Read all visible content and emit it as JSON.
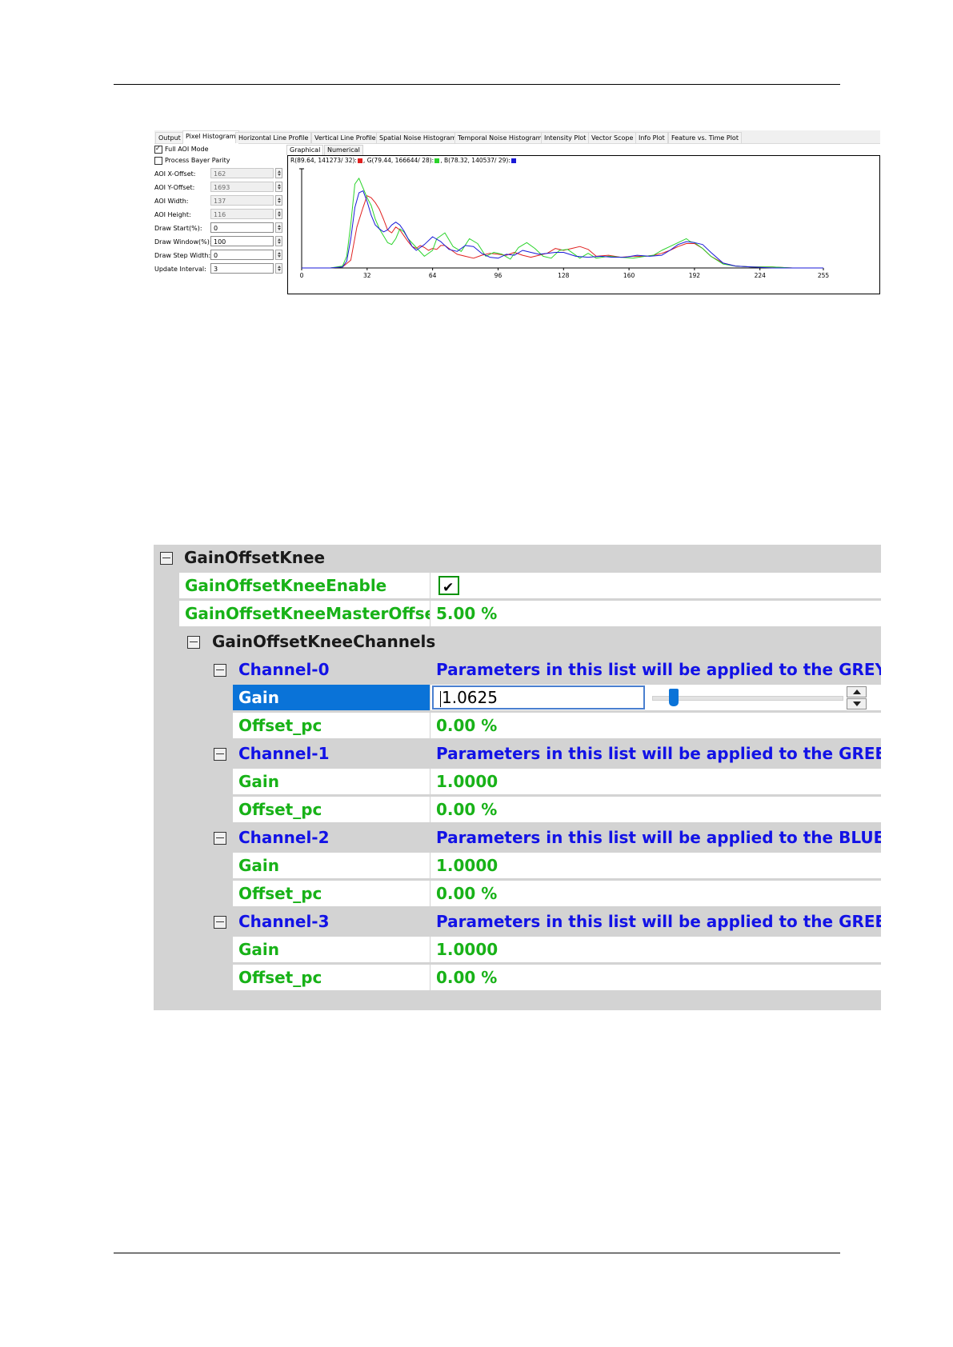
{
  "histogram_panel": {
    "tabs": [
      "Output",
      "Pixel Histogram",
      "Horizontal Line Profile",
      "Vertical Line Profile",
      "Spatial Noise Histogram",
      "Temporal Noise Histogram",
      "Intensity Plot",
      "Vector Scope",
      "Info Plot",
      "Feature vs. Time Plot"
    ],
    "active_tab": "Pixel Histogram",
    "checkboxes": [
      {
        "label": "Full AOI Mode",
        "checked": true
      },
      {
        "label": "Process Bayer Parity",
        "checked": false
      }
    ],
    "params": [
      {
        "label": "AOI X-Offset:",
        "value": "162",
        "editable": false
      },
      {
        "label": "AOI Y-Offset:",
        "value": "1693",
        "editable": false
      },
      {
        "label": "AOI Width:",
        "value": "137",
        "editable": false
      },
      {
        "label": "AOI Height:",
        "value": "116",
        "editable": false
      },
      {
        "label": "Draw Start(%):",
        "value": "0",
        "editable": true
      },
      {
        "label": "Draw Window(%):",
        "value": "100",
        "editable": true
      },
      {
        "label": "Draw Step Width:",
        "value": "0",
        "editable": true
      },
      {
        "label": "Update Interval:",
        "value": "3",
        "editable": true
      }
    ],
    "sub_tabs": [
      "Graphical",
      "Numerical"
    ],
    "active_sub_tab": "Graphical",
    "stats": {
      "r": "R(89.64, 141273/  32):",
      "g": ", G(79.44, 166644/  28):",
      "b": ", B(78.32, 140537/  29):"
    }
  },
  "chart_data": {
    "type": "line",
    "x_ticks": [
      "0",
      "32",
      "64",
      "96",
      "128",
      "160",
      "192",
      "224",
      "255"
    ],
    "xlim": [
      0,
      255
    ],
    "ylim": [
      0,
      1
    ],
    "colors": {
      "r": "#e0201f",
      "g": "#2bd32b",
      "b": "#1a1ad8"
    },
    "series": [
      {
        "key": "r",
        "x": [
          0,
          14,
          20,
          24,
          27,
          30,
          32,
          34,
          36,
          38,
          40,
          42,
          44,
          46,
          48,
          50,
          52,
          54,
          56,
          58,
          60,
          62,
          64,
          66,
          68,
          70,
          72,
          76,
          80,
          84,
          88,
          92,
          96,
          100,
          104,
          108,
          112,
          116,
          120,
          124,
          128,
          132,
          136,
          140,
          144,
          150,
          156,
          162,
          168,
          172,
          176,
          180,
          184,
          188,
          192,
          196,
          200,
          206,
          212,
          220,
          230,
          240,
          255
        ],
        "y": [
          0,
          0,
          0.01,
          0.08,
          0.42,
          0.62,
          0.74,
          0.72,
          0.67,
          0.6,
          0.5,
          0.39,
          0.36,
          0.42,
          0.39,
          0.33,
          0.27,
          0.22,
          0.2,
          0.23,
          0.21,
          0.18,
          0.2,
          0.19,
          0.23,
          0.23,
          0.2,
          0.14,
          0.12,
          0.1,
          0.13,
          0.15,
          0.14,
          0.13,
          0.16,
          0.13,
          0.11,
          0.13,
          0.15,
          0.2,
          0.18,
          0.2,
          0.22,
          0.19,
          0.12,
          0.13,
          0.11,
          0.12,
          0.12,
          0.13,
          0.15,
          0.18,
          0.22,
          0.25,
          0.25,
          0.2,
          0.12,
          0.05,
          0.02,
          0.01,
          0.01,
          0,
          0
        ]
      },
      {
        "key": "g",
        "x": [
          0,
          14,
          20,
          22,
          24,
          26,
          28,
          30,
          32,
          34,
          36,
          38,
          40,
          42,
          44,
          46,
          48,
          50,
          52,
          56,
          60,
          64,
          66,
          70,
          74,
          78,
          82,
          86,
          90,
          94,
          98,
          102,
          106,
          110,
          114,
          118,
          122,
          126,
          130,
          136,
          140,
          144,
          150,
          156,
          162,
          168,
          172,
          176,
          180,
          184,
          188,
          190,
          192,
          196,
          200,
          206,
          212,
          220,
          230,
          240,
          255
        ],
        "y": [
          0,
          0,
          0.02,
          0.12,
          0.45,
          0.86,
          0.92,
          0.82,
          0.72,
          0.64,
          0.5,
          0.4,
          0.33,
          0.26,
          0.24,
          0.3,
          0.4,
          0.37,
          0.3,
          0.21,
          0.12,
          0.18,
          0.3,
          0.36,
          0.22,
          0.17,
          0.3,
          0.25,
          0.12,
          0.16,
          0.14,
          0.09,
          0.21,
          0.26,
          0.2,
          0.12,
          0.1,
          0.18,
          0.19,
          0.1,
          0.15,
          0.1,
          0.12,
          0.11,
          0.1,
          0.12,
          0.13,
          0.18,
          0.22,
          0.26,
          0.3,
          0.27,
          0.26,
          0.2,
          0.12,
          0.04,
          0.02,
          0.01,
          0.01,
          0,
          0
        ]
      },
      {
        "key": "b",
        "x": [
          0,
          14,
          20,
          22,
          24,
          26,
          28,
          30,
          32,
          34,
          36,
          38,
          40,
          42,
          44,
          46,
          48,
          50,
          52,
          54,
          56,
          60,
          64,
          68,
          72,
          76,
          80,
          84,
          88,
          92,
          96,
          100,
          104,
          108,
          112,
          116,
          120,
          124,
          128,
          134,
          140,
          146,
          152,
          158,
          164,
          170,
          176,
          180,
          184,
          188,
          192,
          196,
          200,
          206,
          212,
          220,
          230,
          240,
          255
        ],
        "y": [
          0,
          0,
          0.01,
          0.07,
          0.3,
          0.62,
          0.77,
          0.79,
          0.68,
          0.54,
          0.44,
          0.4,
          0.37,
          0.39,
          0.44,
          0.47,
          0.44,
          0.38,
          0.3,
          0.22,
          0.18,
          0.24,
          0.32,
          0.27,
          0.19,
          0.17,
          0.23,
          0.22,
          0.15,
          0.11,
          0.1,
          0.14,
          0.13,
          0.18,
          0.16,
          0.14,
          0.15,
          0.16,
          0.16,
          0.12,
          0.11,
          0.12,
          0.11,
          0.11,
          0.13,
          0.12,
          0.13,
          0.18,
          0.24,
          0.27,
          0.26,
          0.24,
          0.16,
          0.05,
          0.02,
          0.01,
          0,
          0,
          0
        ]
      }
    ]
  },
  "property_grid": {
    "root": {
      "label": "GainOffsetKnee"
    },
    "enable": {
      "label": "GainOffsetKneeEnable",
      "checked": true
    },
    "master_offset": {
      "label": "GainOffsetKneeMasterOffset_p",
      "value": "5.00 %"
    },
    "channels_group": {
      "label": "GainOffsetKneeChannels"
    },
    "channels": [
      {
        "label": "Channel-0",
        "description": "Parameters in this list will be applied to the GREY channel",
        "gain_label": "Gain",
        "gain": "1.0625",
        "offset_label": "Offset_pc",
        "offset": "0.00 %"
      },
      {
        "label": "Channel-1",
        "description": "Parameters in this list will be applied to the GREEN channel",
        "gain_label": "Gain",
        "gain": "1.0000",
        "offset_label": "Offset_pc",
        "offset": "0.00 %"
      },
      {
        "label": "Channel-2",
        "description": "Parameters in this list will be applied to the BLUE channel",
        "gain_label": "Gain",
        "gain": "1.0000",
        "offset_label": "Offset_pc",
        "offset": "0.00 %"
      },
      {
        "label": "Channel-3",
        "description": "Parameters in this list will be applied to the GREEN channel",
        "gain_label": "Gain",
        "gain": "1.0000",
        "offset_label": "Offset_pc",
        "offset": "0.00 %"
      }
    ],
    "gain_slider_fraction": 0.11,
    "colors": {
      "label_green": "#18b218",
      "description_blue": "#1212e6",
      "selection": "#0a73d8"
    }
  }
}
